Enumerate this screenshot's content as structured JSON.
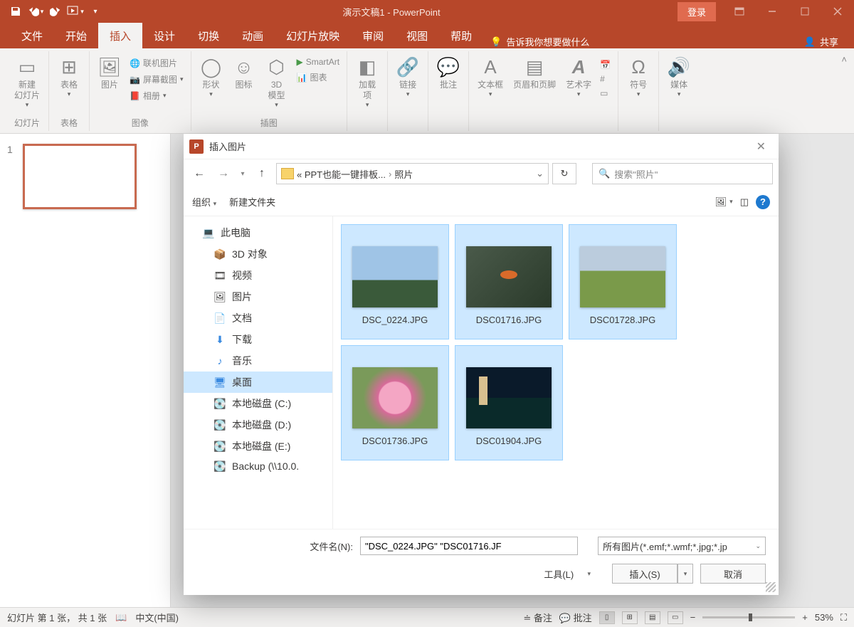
{
  "title": "演示文稿1 - PowerPoint",
  "qat": {
    "save": "💾",
    "undo": "↶",
    "redo": "↻",
    "start": "▢",
    "more": "▾"
  },
  "login_btn": "登录",
  "tabs": [
    "文件",
    "开始",
    "插入",
    "设计",
    "切换",
    "动画",
    "幻灯片放映",
    "审阅",
    "视图",
    "帮助"
  ],
  "tellme": "告诉我你想要做什么",
  "share": "共享",
  "ribbon": {
    "new_slide": "新建\n幻灯片",
    "table": "表格",
    "g_slides": "幻灯片",
    "g_tables": "表格",
    "pictures": "图片",
    "online_pic": "联机图片",
    "screenshot": "屏幕截图",
    "album": "相册",
    "g_images": "图像",
    "shapes": "形状",
    "icons": "图标",
    "model3d": "3D\n模型",
    "smartart": "SmartArt",
    "chart": "图表",
    "g_illus": "插图",
    "addins": "加载\n项",
    "links": "链接",
    "comment": "批注",
    "textbox": "文本框",
    "headerfooter": "页眉和页脚",
    "wordart": "艺术字",
    "symbol": "符号",
    "media": "媒体"
  },
  "slide": {
    "num": "1"
  },
  "status": {
    "slide_info": "幻灯片 第 1 张， 共 1 张",
    "lang": "中文(中国)",
    "notes": "备注",
    "comments": "批注",
    "zoom": "53%"
  },
  "dialog": {
    "title": "插入图片",
    "path_prefix": "«  PPT也能一键排板...",
    "path_sep": "›",
    "path_current": "照片",
    "search_placeholder": "搜索\"照片\"",
    "organize": "组织",
    "new_folder": "新建文件夹",
    "tree": {
      "this_pc": "此电脑",
      "items": [
        "3D 对象",
        "视频",
        "图片",
        "文档",
        "下载",
        "音乐",
        "桌面",
        "本地磁盘 (C:)",
        "本地磁盘 (D:)",
        "本地磁盘 (E:)",
        "Backup (\\\\10.0."
      ]
    },
    "files": [
      {
        "name": "DSC_0224.JPG",
        "cls": "t0"
      },
      {
        "name": "DSC01716.JPG",
        "cls": "t1"
      },
      {
        "name": "DSC01728.JPG",
        "cls": "t2"
      },
      {
        "name": "DSC01736.JPG",
        "cls": "t3"
      },
      {
        "name": "DSC01904.JPG",
        "cls": "t4"
      }
    ],
    "fn_label": "文件名(N):",
    "fn_value": "\"DSC_0224.JPG\" \"DSC01716.JF",
    "filetype": "所有图片(*.emf;*.wmf;*.jpg;*.jp",
    "tools": "工具(L)",
    "insert": "插入(S)",
    "cancel": "取消"
  }
}
